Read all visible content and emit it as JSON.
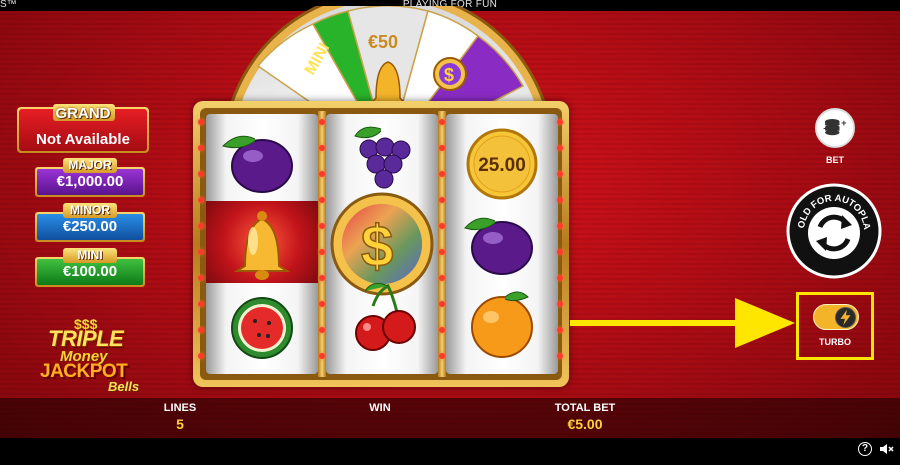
{
  "topbar": {
    "title": "PLAYING FOR FUN",
    "left_fragment": "S™"
  },
  "jackpots": {
    "grand": {
      "label": "GRAND",
      "value": "Not Available"
    },
    "major": {
      "label": "MAJOR",
      "value": "€1,000.00"
    },
    "minor": {
      "label": "MINOR",
      "value": "€250.00"
    },
    "mini": {
      "label": "MINI",
      "value": "€100.00"
    }
  },
  "logo": {
    "line1": "$$$",
    "line2": "TRIPLE",
    "line3": "Money",
    "line4": "JACKPOT",
    "line5": "Bells",
    "tm": "™"
  },
  "wheel": {
    "segments": [
      "MINI",
      "€50"
    ]
  },
  "reels": {
    "reel1": [
      "plum-icon",
      "bell-icon",
      "watermelon-icon"
    ],
    "reel2": [
      "grapes-icon",
      "dollar-coin-icon",
      "cherries-icon"
    ],
    "reel3": [
      "coin-value",
      "plum-icon",
      "orange-icon"
    ],
    "coin_value": "25.00"
  },
  "controls": {
    "bet_label": "BET",
    "autoplay_label": "HOLD FOR AUTOPLAY",
    "turbo_label": "TURBO",
    "turbo_on": true
  },
  "bottom": {
    "lines_label": "LINES",
    "lines_value": "5",
    "win_label": "WIN",
    "win_value": "",
    "total_bet_label": "TOTAL BET",
    "total_bet_value": "€5.00"
  },
  "colors": {
    "accent": "#ffd23a",
    "highlight": "#ffe600",
    "background": "#b50d15"
  }
}
